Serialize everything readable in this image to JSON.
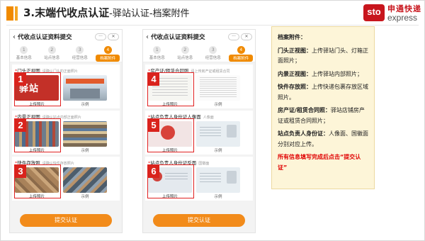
{
  "header": {
    "title_main": "3.末端代收点认证",
    "title_sub": "-驿站认证-档案附件"
  },
  "logo": {
    "mark": "sto",
    "cn": "申通快递",
    "en": "express"
  },
  "phone_left": {
    "title": "代收点认证资料提交",
    "back": "‹",
    "caps": [
      "···",
      "✕"
    ],
    "steps": [
      {
        "n": "1",
        "label": "基本信息"
      },
      {
        "n": "2",
        "label": "站点信息"
      },
      {
        "n": "3",
        "label": "经营信息"
      },
      {
        "n": "4",
        "label": "档案附件"
      }
    ],
    "sections": [
      {
        "title": "门头正视图",
        "hint": "请确认门头的正面照片",
        "upload": "上传照片",
        "example": "示例",
        "badge": "1",
        "sign_text": "驿站"
      },
      {
        "title": "内景正视图",
        "hint": "请确认站点内部正面照片",
        "upload": "上传照片",
        "example": "示例",
        "badge": "2"
      },
      {
        "title": "快件存放照",
        "hint": "请确认快件存放照片",
        "upload": "上传照片",
        "example": "示例",
        "badge": "3"
      }
    ],
    "submit": "提交认证"
  },
  "phone_right": {
    "title": "代收点认证资料提交",
    "back": "‹",
    "caps": [
      "···",
      "✕"
    ],
    "steps": [
      {
        "n": "1",
        "label": "基本信息"
      },
      {
        "n": "2",
        "label": "站点信息"
      },
      {
        "n": "3",
        "label": "经营信息"
      },
      {
        "n": "4",
        "label": "档案附件"
      }
    ],
    "sections": [
      {
        "title": "房产证/租赁合同照",
        "hint": "请上传房产证或租赁合同",
        "upload": "上传照片",
        "example": "示例",
        "badge": "4"
      },
      {
        "title": "站点负责人身份证人像面",
        "hint": "人像面",
        "upload": "上传照片",
        "example": "示例",
        "badge": "5"
      },
      {
        "title": "站点负责人身份证反面",
        "hint": "国徽面",
        "upload": "上传照片",
        "example": "示例",
        "badge": "6"
      }
    ],
    "submit": "提交认证"
  },
  "panel": {
    "title": "档案附件：",
    "items": [
      {
        "key": "门头正视图：",
        "text": "上传驿站门头、灯箱正面照片；"
      },
      {
        "key": "内景正视图：",
        "text": "上传驿站内部照片；"
      },
      {
        "key": "快件存放照：",
        "text": "上传快递包裹存放区域照片。"
      },
      {
        "key": "房产证/租赁合同照：",
        "text": "驿站店铺房产证或租赁合同照片；"
      },
      {
        "key": "站点负责人身份证：",
        "text": "人像面、国徽面分别对应上传。"
      }
    ],
    "warning": "所有信息填写完成后点击“提交认证”"
  },
  "colors": {
    "accent": "#f08a00",
    "badge_red": "#d9231c",
    "panel_bg": "#fdf5d8",
    "warning": "#e00000"
  }
}
